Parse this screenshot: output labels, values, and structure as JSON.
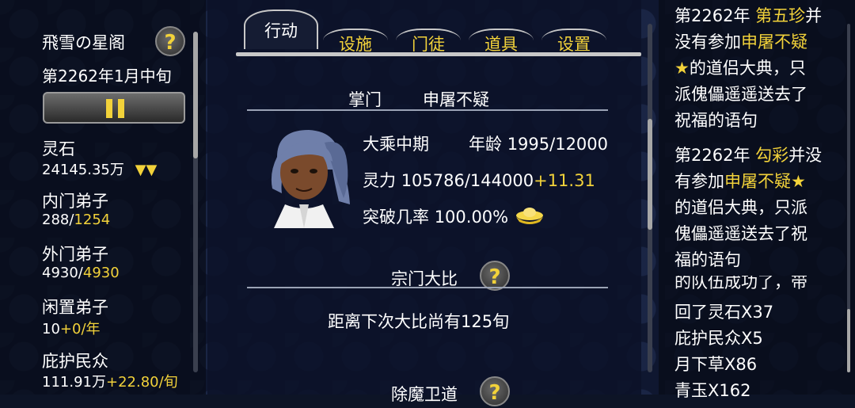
{
  "sect": {
    "name": "飛雪の星阁",
    "date": "第2262年1月中旬",
    "help": "?"
  },
  "stats": {
    "spirit_stone_label": "灵石",
    "spirit_stone_value": "24145.35万",
    "spirit_stone_trend": "▼▼",
    "inner_label": "内门弟子",
    "inner_current": "288/",
    "inner_max": "1254",
    "outer_label": "外门弟子",
    "outer_current": "4930/",
    "outer_max": "4930",
    "idle_label": "闲置弟子",
    "idle_value": "10",
    "idle_rate": "+0/年",
    "protect_label": "庇护民众",
    "protect_value": "111.91万",
    "protect_rate": "+22.80/旬"
  },
  "tabs": [
    "行动",
    "设施",
    "门徒",
    "道具",
    "设置"
  ],
  "leader": {
    "title_label": "掌门",
    "name": "申屠不疑",
    "realm": "大乘中期",
    "age_label": "年龄",
    "age_value": "1995/12000",
    "power_label": "灵力",
    "power_value": "105786/144000",
    "power_rate": "+11.31",
    "break_label": "突破几率",
    "break_value": "100.00%"
  },
  "tournament": {
    "title": "宗门大比",
    "help": "?",
    "countdown": "距离下次大比尚有125旬"
  },
  "demon": {
    "title": "除魔卫道",
    "help": "?"
  },
  "log": {
    "e1_a": "第2262年",
    "e1_name": "第五珍",
    "e1_b": "并",
    "e1_c": "没有参加",
    "e1_host": "申屠不疑",
    "e1_star": "★",
    "e1_d": "的道侣大典，只",
    "e1_e": "派傀儡遥遥送去了",
    "e1_f": "祝福的语句",
    "e2_a": "第2262年",
    "e2_name": "勾彩",
    "e2_b": "并没",
    "e2_c": "有参加",
    "e2_host": "申屠不疑★",
    "e2_d": "的道侣大典，只派",
    "e2_e": "傀儡遥遥送去了祝",
    "e2_f": "福的语句",
    "e3_partial": "的队伍成功了，带",
    "e3_a": "回了灵石X37",
    "e3_b": "庇护民众X5",
    "e3_c": "月下草X86",
    "e3_d": "青玉X162"
  }
}
